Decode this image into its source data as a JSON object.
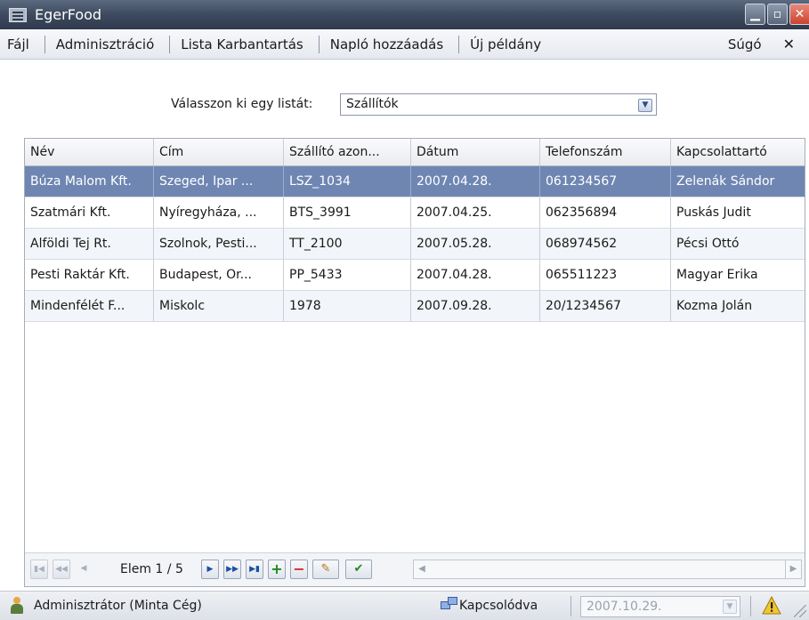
{
  "window": {
    "title": "EgerFood"
  },
  "menu": {
    "items": [
      "Fájl",
      "Adminisztráció",
      "Lista Karbantartás",
      "Napló hozzáadás",
      "Új példány"
    ],
    "help": "Súgó",
    "close_glyph": "✕"
  },
  "list_selector": {
    "label": "Válasszon ki egy listát:",
    "value": "Szállítók"
  },
  "grid": {
    "columns": [
      "Név",
      "Cím",
      "Szállító azon...",
      "Dátum",
      "Telefonszám",
      "Kapcsolattartó"
    ],
    "rows": [
      [
        "Búza Malom Kft.",
        "Szeged, Ipar ...",
        "LSZ_1034",
        "2007.04.28.",
        "061234567",
        "Zelenák Sándor"
      ],
      [
        "Szatmári Kft.",
        "Nyíregyháza, ...",
        "BTS_3991",
        "2007.04.25.",
        "062356894",
        "Puskás Judit"
      ],
      [
        "Alföldi Tej Rt.",
        "Szolnok, Pesti...",
        "TT_2100",
        "2007.05.28.",
        "068974562",
        "Pécsi Ottó"
      ],
      [
        "Pesti Raktár Kft.",
        "Budapest, Or...",
        "PP_5433",
        "2007.04.28.",
        "065511223",
        "Magyar Erika"
      ],
      [
        "Mindenfélét F...",
        "Miskolc",
        "1978",
        "2007.09.28.",
        "20/1234567",
        "Kozma Jolán"
      ]
    ],
    "selected_row_index": 0
  },
  "navigator": {
    "position_label": "Elem 1 / 5"
  },
  "status": {
    "user": "Adminisztrátor (Minta Cég)",
    "connection": "Kapcsolódva",
    "date": "2007.10.29."
  },
  "icons": {
    "app": "app-icon",
    "user": "user-icon",
    "connection": "network-icon",
    "warning": "warning-icon"
  },
  "colors": {
    "titlebar": "#3f4c61",
    "selected_row": "#6f86b3",
    "close_button": "#c9442e"
  }
}
